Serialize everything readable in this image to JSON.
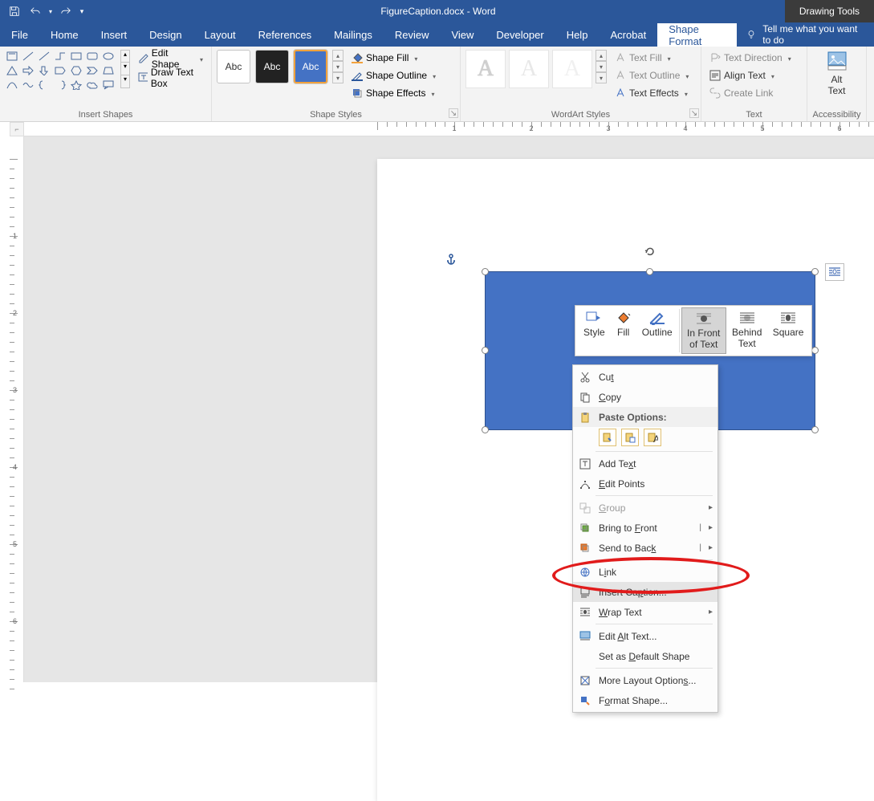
{
  "title": {
    "doc": "FigureCaption.docx",
    "suffix": "  -  Word",
    "tools_tab": "Drawing Tools"
  },
  "tabs": [
    "File",
    "Home",
    "Insert",
    "Design",
    "Layout",
    "References",
    "Mailings",
    "Review",
    "View",
    "Developer",
    "Help",
    "Acrobat",
    "Shape Format"
  ],
  "tell_me": "Tell me what you want to do",
  "groups": {
    "insert_shapes": {
      "label": "Insert Shapes",
      "edit_shape": "Edit Shape",
      "draw_text_box": "Draw Text Box"
    },
    "shape_styles": {
      "label": "Shape Styles",
      "sample": "Abc",
      "fill": "Shape Fill",
      "outline": "Shape Outline",
      "effects": "Shape Effects"
    },
    "wordart": {
      "label": "WordArt Styles",
      "text_fill": "Text Fill",
      "text_outline": "Text Outline",
      "text_effects": "Text Effects"
    },
    "text": {
      "label": "Text",
      "direction": "Text Direction",
      "align": "Align Text",
      "link": "Create Link"
    },
    "accessibility": {
      "label": "Accessibility",
      "alt": "Alt\nText"
    }
  },
  "mini_toolbar": {
    "style": "Style",
    "fill": "Fill",
    "outline": "Outline",
    "infront": "In Front of Text",
    "behind": "Behind Text",
    "square": "Square"
  },
  "context_menu": {
    "cut": "Cut",
    "copy": "Copy",
    "paste_header": "Paste Options:",
    "add_text": "Add Text",
    "edit_points": "Edit Points",
    "group": "Group",
    "bring_front": "Bring to Front",
    "send_back": "Send to Back",
    "link": "Link",
    "insert_caption": "Insert Caption...",
    "wrap_text": "Wrap Text",
    "edit_alt": "Edit Alt Text...",
    "default_shape": "Set as Default Shape",
    "more_layout": "More Layout Options...",
    "format_shape": "Format Shape..."
  },
  "ruler": {
    "h": [
      1,
      2,
      3,
      4,
      5
    ],
    "v": [
      1,
      2,
      3,
      4,
      5
    ]
  }
}
